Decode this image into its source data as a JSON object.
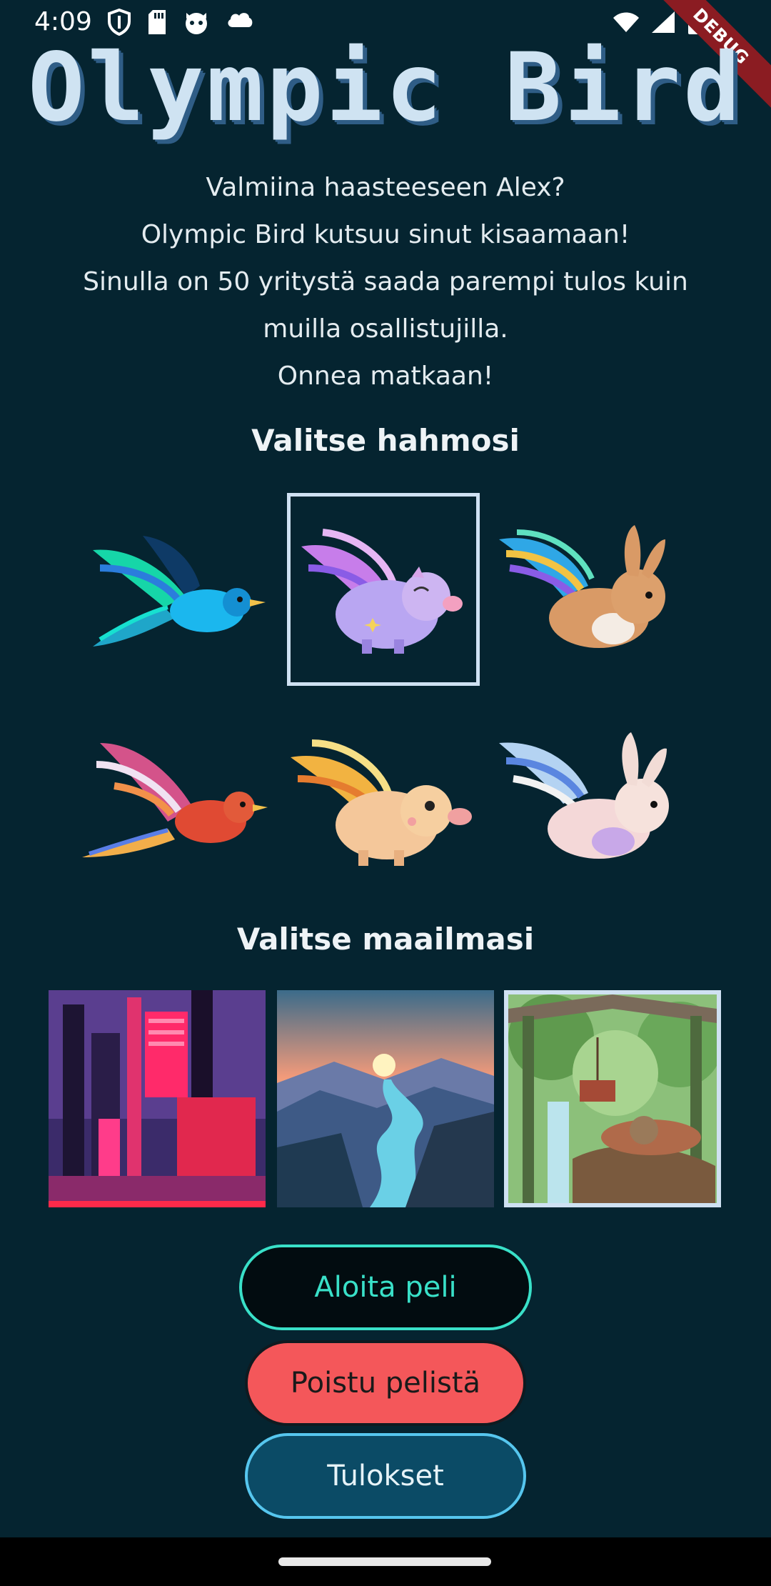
{
  "status_bar": {
    "time": "4:09",
    "debug_label": "DEBUG"
  },
  "title": "Olympic Bird",
  "intro": [
    "Valmiina haasteeseen Alex?",
    "Olympic Bird kutsuu sinut kisaamaan!",
    "Sinulla on 50 yritystä saada parempi tulos kuin",
    "muilla osallistujilla.",
    "Onnea matkaan!"
  ],
  "characters_heading": "Valitse hahmosi",
  "characters": [
    {
      "icon": "blue-bird-icon",
      "selected": false
    },
    {
      "icon": "flying-pig-purple-icon",
      "selected": true
    },
    {
      "icon": "winged-bunny-brown-icon",
      "selected": false
    },
    {
      "icon": "red-bird-icon",
      "selected": false
    },
    {
      "icon": "flying-pig-gold-icon",
      "selected": false
    },
    {
      "icon": "winged-bunny-white-icon",
      "selected": false
    }
  ],
  "worlds_heading": "Valitse maailmasi",
  "worlds": [
    {
      "icon": "cyberpunk-city-icon",
      "selected": false
    },
    {
      "icon": "sunset-valley-icon",
      "selected": false
    },
    {
      "icon": "jungle-ruins-icon",
      "selected": true
    }
  ],
  "buttons": {
    "start": "Aloita peli",
    "exit": "Poistu pelistä",
    "results": "Tulokset"
  },
  "colors": {
    "background": "#052430",
    "accent_start": "#39e0c8",
    "exit_red": "#f4575a",
    "results_blue": "#0b4b66",
    "selection_border": "#cfe1f2"
  }
}
